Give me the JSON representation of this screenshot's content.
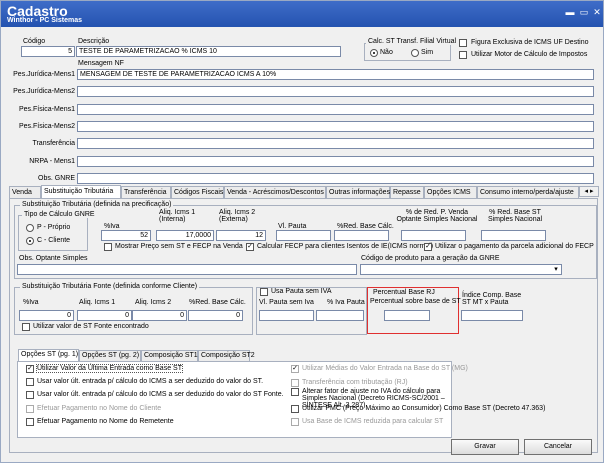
{
  "window": {
    "title": "Cadastro",
    "subtitle": "Winthor - PC Sistemas",
    "btn_min": "▬",
    "btn_restore": "▭",
    "btn_close": "✕"
  },
  "header": {
    "codigo_label": "Código",
    "codigo_value": "5",
    "descricao_label": "Descrição",
    "descricao_value": "TESTE DE PARAMETRIZACAO % ICMS 10",
    "calc_label": "Calc. ST Transf. Filial Virtual",
    "radio_nao": "Não",
    "radio_sim": "Sim",
    "chk_figura": "Figura Exclusiva de ICMS UF Destino",
    "chk_motor": "Utilizar Motor de Cálculo de Impostos"
  },
  "mensagens": {
    "header": "Mensagem NF",
    "rows": [
      {
        "label": "Pes.Jurídica-Mens1",
        "value": "MENSAGEM DE TESTE DE PARAMETRIZACAO ICMS A 10%"
      },
      {
        "label": "Pes.Jurídica-Mens2",
        "value": ""
      },
      {
        "label": "Pes.Física-Mens1",
        "value": ""
      },
      {
        "label": "Pes.Física-Mens2",
        "value": ""
      },
      {
        "label": "Transferência",
        "value": ""
      },
      {
        "label": "NRPA - Mens1",
        "value": ""
      },
      {
        "label": "Obs. GNRE",
        "value": ""
      }
    ]
  },
  "tabs": [
    "Venda",
    "Substituição Tributária",
    "Transferência",
    "Códigos Fiscais",
    "Venda - Acréscimos/Descontos",
    "Outras informações",
    "Repasse",
    "Opções ICMS",
    "Consumo interno/perda/ajuste"
  ],
  "st": {
    "group_label": "Substituição Tributária (definida na precificação)",
    "tipo_label": "Tipo de Cálculo GNRE",
    "tipo_p": "P - Próprio",
    "tipo_c": "C - Cliente",
    "h_iva": "%Iva",
    "h_icms1": "Aliq. Icms 1 (Interna)",
    "h_icms2": "Aliq. Icms 2 (Externa)",
    "h_pauta": "Vl. Pauta",
    "h_redbase": "%Red. Base Cálc.",
    "h_redvenda": "% de Red. P. Venda Optante Simples Nacional",
    "h_redst": "% Red. Base ST Simples Nacional",
    "v_iva": "52",
    "v_icms1": "17,0000",
    "v_icms2": "12",
    "chk_mostrar": "Mostrar Preço sem ST e FECP na Venda",
    "chk_fecp": "Calcular FECP para clientes Isentos de IE(ICMS normal)",
    "chk_parcela": "Utilizar o pagamento da parcela adicional do FECP",
    "obs_label": "Obs. Optante Simples",
    "cod_gnre_label": "Código de produto para a geração da GNRE"
  },
  "fonte": {
    "group_label": "Substituição Tributária Fonte (definida conforme Cliente)",
    "h_iva": "%Iva",
    "h_icms1": "Aliq. Icms 1",
    "h_icms2": "Aliq. Icms 2",
    "h_red": "%Red. Base Cálc.",
    "v_iva": "0",
    "v_icms1": "0",
    "v_icms2": "0",
    "v_red": "0",
    "chk_utilizar": "Utilizar valor de ST Fonte encontrado"
  },
  "pauta": {
    "chk_usa": "Usa Pauta sem IVA",
    "h_vl": "Vl. Pauta sem Iva",
    "h_iva": "% Iva Pauta",
    "rj_label": "Percentual Base RJ",
    "rj_sub": "Percentual sobre base de ST",
    "indice": "Índice Comp. Base ST MT x Pauta"
  },
  "subtabs": [
    "Opções ST (pg. 1)",
    "Opções ST (pg. 2)",
    "Composição ST1",
    "Composição ST2"
  ],
  "opcoes_left": [
    {
      "text": "Utilizar Valor da Última Entrada como Base ST",
      "checked": true,
      "disabled": false
    },
    {
      "text": "Usar valor últ. entrada p/ cálculo do ICMS a ser deduzido do valor do ST.",
      "checked": false,
      "disabled": false
    },
    {
      "text": "Usar valor últ. entrada p/ cálculo do ICMS a ser deduzido do valor do ST Fonte.",
      "checked": false,
      "disabled": false
    },
    {
      "text": "Efetuar Pagamento no Nome do Cliente",
      "checked": false,
      "disabled": true
    },
    {
      "text": "Efetuar Pagamento no Nome do Remetente",
      "checked": false,
      "disabled": false
    }
  ],
  "opcoes_right": [
    {
      "text": "Utilizar Médias do Valor Entrada na Base do ST (MG)",
      "checked": true,
      "disabled": true
    },
    {
      "text": "Transferência com tributação (RJ)",
      "checked": false,
      "disabled": true
    },
    {
      "text": "Alterar fator de ajuste no IVA do cálculo para Simples Nacional (Decreto RICMS-SC/2001 – SÍNTESE Alt. 3.287).",
      "checked": false,
      "disabled": false
    },
    {
      "text": "Utilizar PMC (Preço Máximo ao Consumidor) Como Base ST (Decreto 47.363)",
      "checked": false,
      "disabled": false
    },
    {
      "text": "Usa Base de ICMS reduzida para calcular ST",
      "checked": false,
      "disabled": true
    }
  ],
  "footer": {
    "gravar": "Gravar",
    "cancelar": "Cancelar"
  }
}
